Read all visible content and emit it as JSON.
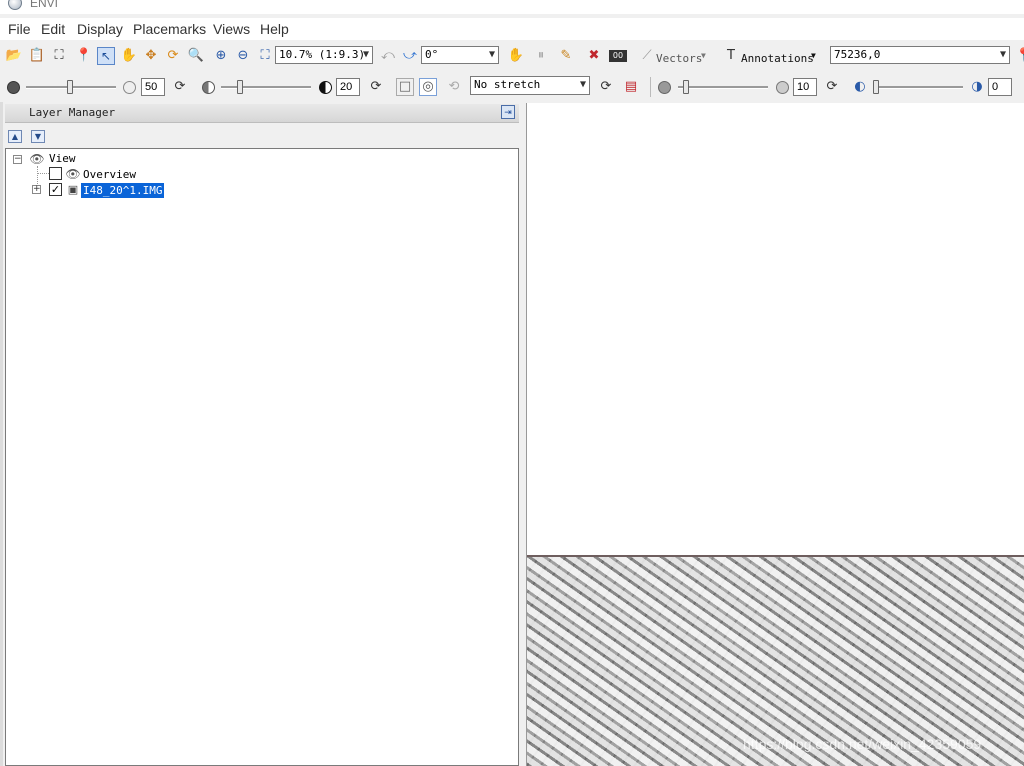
{
  "window": {
    "title": "ENVI"
  },
  "menu": [
    "File",
    "Edit",
    "Display",
    "Placemarks",
    "Views",
    "Help"
  ],
  "toolbar": {
    "zoom_value": "10.7% (1:9.3)",
    "rotation_value": "0°",
    "vectors_label": "Vectors",
    "annotations_label": "Annotations",
    "location_value": "75236,0"
  },
  "toolbar2": {
    "brightness_value": "50",
    "contrast_value": "20",
    "stretch_value": "No stretch",
    "sharpen_value": "10",
    "transparency_value": "0"
  },
  "layer_manager": {
    "title": "Layer Manager",
    "tree": {
      "root": "View",
      "items": [
        {
          "label": "Overview",
          "checked": false
        },
        {
          "label": "I48_20^1.IMG",
          "checked": true,
          "selected": true
        }
      ]
    }
  },
  "viewport": {
    "watermark": "https://blog.csdn.net/weixin_42359059"
  }
}
